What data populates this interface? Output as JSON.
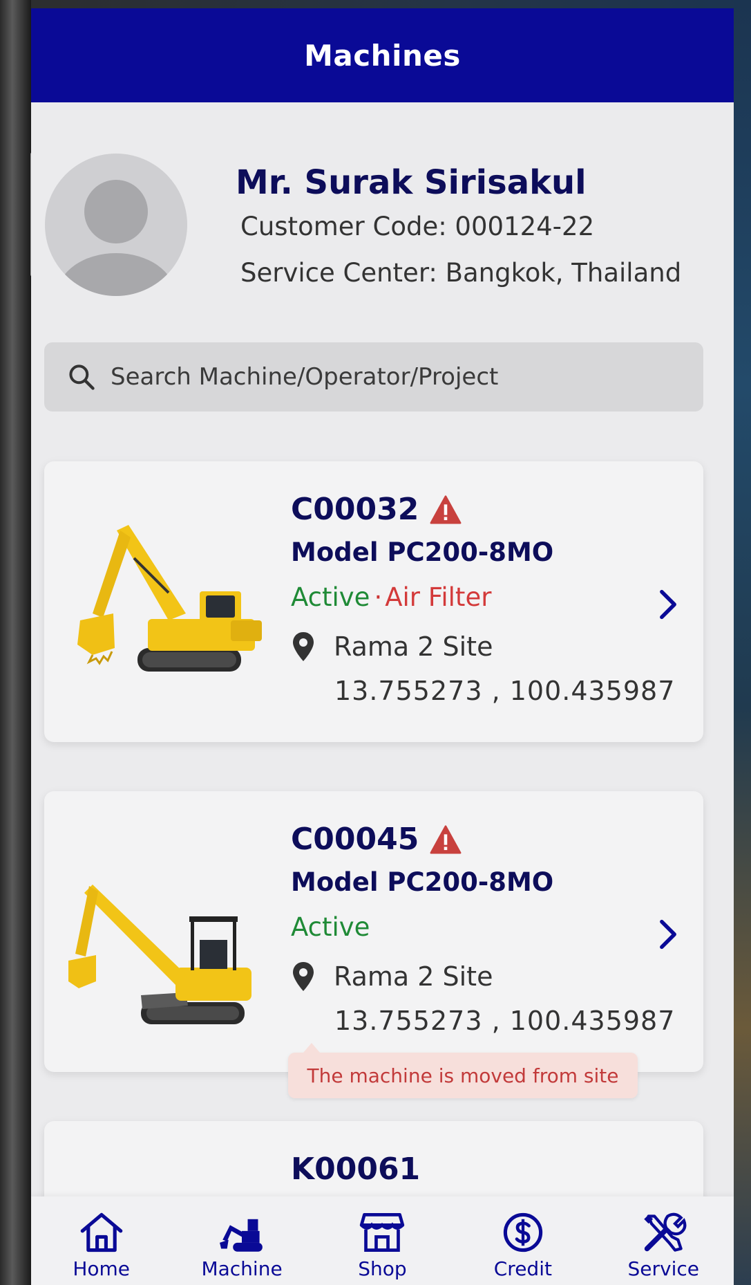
{
  "appbar": {
    "title": "Machines"
  },
  "profile": {
    "name": "Mr. Surak Sirisakul",
    "customer_code": "Customer Code: 000124-22",
    "service_center": "Service Center: Bangkok, Thailand"
  },
  "search": {
    "placeholder": "Search Machine/Operator/Project"
  },
  "machines": [
    {
      "code": "C00032",
      "has_warning": true,
      "model": "Model PC200-8MO",
      "status": "Active",
      "status_separator": "·",
      "alert": "Air Filter",
      "location": "Rama 2 Site",
      "coordinates": "13.755273 , 100.435987"
    },
    {
      "code": "C00045",
      "has_warning": true,
      "model": "Model PC200-8MO",
      "status": "Active",
      "location": "Rama 2 Site",
      "coordinates": "13.755273 , 100.435987",
      "tooltip": "The machine is moved from site"
    },
    {
      "code": "K00061"
    }
  ],
  "tabbar": {
    "items": [
      {
        "label": "Home",
        "icon": "home-icon"
      },
      {
        "label": "Machine",
        "icon": "excavator-icon"
      },
      {
        "label": "Shop",
        "icon": "store-icon"
      },
      {
        "label": "Credit",
        "icon": "dollar-circle-icon"
      },
      {
        "label": "Service",
        "icon": "tools-icon"
      }
    ]
  },
  "colors": {
    "appbar": "#0a0a96",
    "navy_text": "#0d0d5a",
    "active_green": "#1f8a36",
    "alert_red": "#d33a3a",
    "warning_red": "#c8413e"
  }
}
